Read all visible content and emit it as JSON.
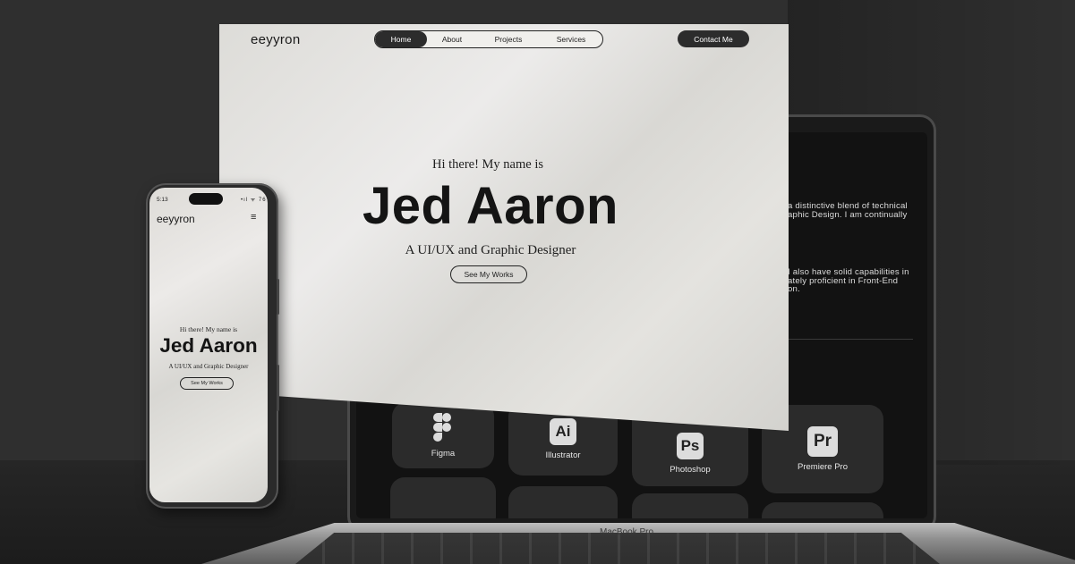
{
  "laptop": {
    "brand_label": "MacBook Pro",
    "about_lines": [
      "a distinctive blend of technical",
      "aphic Design. I am continually",
      "I also have solid capabilities in",
      "ately proficient in Front-End",
      "on."
    ],
    "tools": [
      {
        "label": "Figma",
        "icon": "figma-icon"
      },
      {
        "label": "Illustrator",
        "icon": "Ai"
      },
      {
        "label": "Photoshop",
        "icon": "Ps"
      },
      {
        "label": "Premiere Pro",
        "icon": "Pr"
      }
    ]
  },
  "desktop": {
    "logo": "eeyyron",
    "nav": [
      "Home",
      "About",
      "Projects",
      "Services"
    ],
    "active_nav": "Home",
    "contact_label": "Contact Me",
    "greeting": "Hi there! My name is",
    "name": "Jed Aaron",
    "role": "A UI/UX and Graphic Designer",
    "cta_label": "See My Works"
  },
  "phone": {
    "time": "5:13",
    "status": "•ıl ᯤ 76",
    "logo": "eeyyron",
    "menu_icon": "≡",
    "greeting": "Hi there! My name is",
    "name": "Jed Aaron",
    "role": "A UI/UX and Graphic Designer",
    "cta_label": "See My Works"
  },
  "colors": {
    "background": "#2f2f2f",
    "page_bg": "#e6e5e1",
    "dark_accent": "#2c2c2c",
    "laptop_screen": "#121212",
    "tool_card": "#2b2b2b"
  }
}
